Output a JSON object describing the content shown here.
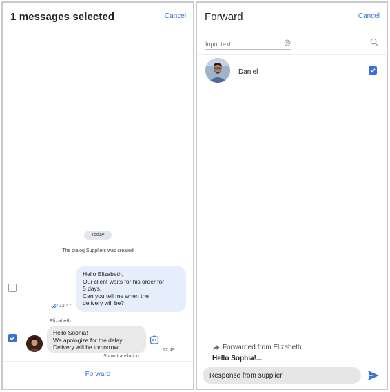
{
  "left": {
    "header": {
      "title": "1 messages selected",
      "cancel_label": "Cancel"
    },
    "day_label": "Today",
    "system_message": "The dialog Suppliers was created",
    "outgoing": {
      "lines": [
        "Hello Elizabeth,",
        "Our client waits for his order for",
        "5 days.",
        "Can you tell me when the",
        "delivery will be?"
      ],
      "time": "12:47",
      "selected": false
    },
    "incoming": {
      "sender": "Elizabeth",
      "lines": [
        "Hello Sophia!",
        "We apologize for the delay.",
        "Delivery will be tomorrow."
      ],
      "time": "12:49",
      "show_translation_label": "Show translation",
      "selected": true
    },
    "footer": {
      "forward_label": "Forward"
    }
  },
  "right": {
    "header": {
      "title": "Forward",
      "cancel_label": "Cancel"
    },
    "search": {
      "placeholder": "Input text...",
      "value": ""
    },
    "contacts": [
      {
        "name": "Daniel",
        "selected": true
      }
    ],
    "forwarded": {
      "from_label": "Forwarded from Elizabeth",
      "preview": "Hello Sophia!..."
    },
    "reply": {
      "value": "Response from supplier",
      "placeholder": ""
    }
  },
  "colors": {
    "accent": "#3a72d4",
    "outgoing_bubble": "#e7eefb",
    "incoming_bubble": "#e9e9ea"
  },
  "icons": [
    "check-icon",
    "double-check-icon",
    "translate-icon",
    "clear-icon",
    "search-icon",
    "forward-arrow-icon",
    "send-icon"
  ]
}
